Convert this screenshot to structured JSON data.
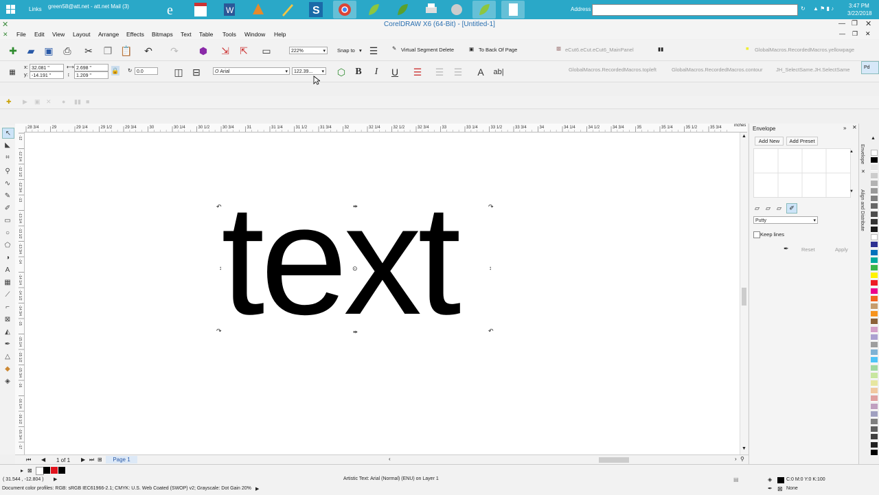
{
  "taskbar": {
    "links_label": "Links",
    "mail_label": "green58@att.net - att.net Mail (3)",
    "address_label": "Address",
    "time": "3:47 PM",
    "date": "3/22/2018",
    "icons": [
      "windows-start-icon",
      "ie-icon",
      "calendar-icon",
      "word-icon",
      "app-icon",
      "pen-icon",
      "s-app-icon",
      "chrome-icon",
      "leaf-icon",
      "leaf-app-icon",
      "printer-icon",
      "app-icon-2",
      "leaf-app-icon-2",
      "document-icon"
    ]
  },
  "window": {
    "title": "CorelDRAW X6 (64-Bit) - [Untitled-1]"
  },
  "menu": [
    "File",
    "Edit",
    "View",
    "Layout",
    "Arrange",
    "Effects",
    "Bitmaps",
    "Text",
    "Table",
    "Tools",
    "Window",
    "Help"
  ],
  "standard_toolbar": {
    "zoom": "222%",
    "snap_to": "Snap to",
    "virtual_segment_delete": "Virtual Segment Delete",
    "to_back_of_page": "To Back Of Page",
    "macro_main_panel": "eCut6.eCut.eCut6_MainPanel",
    "macro_yellowpage": "GlobalMacros.RecordedMacros.yellowpage"
  },
  "property_bar": {
    "x": "32.081 \"",
    "y": "-14.191 \"",
    "width": "2.698 \"",
    "height": "1.209 \"",
    "angle": "0.0",
    "font": "Arial",
    "font_size": "122.39...",
    "macro_topleft": "GlobalMacros.RecordedMacros.topleft",
    "macro_contour": "GlobalMacros.RecordedMacros.contour",
    "macro_selectsame": "JH_SelectSame.JH.SelectSame",
    "macro_cut": "Pd"
  },
  "ruler": {
    "labels": [
      "28 3/4",
      "29",
      "29 1/4",
      "29 1/2",
      "29 3/4",
      "30",
      "30 1/4",
      "30 1/2",
      "30 3/4",
      "31",
      "31 1/4",
      "31 1/2",
      "31 3/4",
      "32",
      "32 1/4",
      "32 1/2",
      "32 3/4",
      "33",
      "33 1/4",
      "33 1/2",
      "33 3/4",
      "34",
      "34 1/4",
      "34 1/2",
      "34 3/4",
      "35",
      "35 1/4",
      "35 1/2",
      "35 3/4"
    ],
    "units": "inches",
    "v_labels": [
      "-12",
      "-12 1/4",
      "-12 1/2",
      "-12 3/4",
      "-13",
      "-13 1/4",
      "-13 1/2",
      "-13 3/4",
      "-14",
      "-14 1/4",
      "-14 1/2",
      "-14 3/4",
      "-15",
      "-15 1/4",
      "-15 1/2",
      "-15 3/4",
      "-16",
      "-16 1/4",
      "-16 1/2",
      "-16 3/4",
      "-17"
    ]
  },
  "canvas": {
    "artistic_text": "text"
  },
  "page_nav": {
    "page_count": "1 of 1",
    "page_tab": "Page 1"
  },
  "docker": {
    "title": "Envelope",
    "add_new": "Add New",
    "add_preset": "Add Preset",
    "mode": "Putty",
    "keep_lines": "Keep lines",
    "reset": "Reset",
    "apply": "Apply"
  },
  "side_tabs": [
    "Envelope",
    "Align and Distribute"
  ],
  "palette": [
    "#ffffff",
    "#000000",
    "#e6e6e6",
    "#cccccc",
    "#b3b3b3",
    "#999999",
    "#808080",
    "#666666",
    "#4d4d4d",
    "#333333",
    "#1a1a1a",
    "#ffffff",
    "#2e3192",
    "#0071bc",
    "#00a99d",
    "#39b54a",
    "#fff200",
    "#ed1c24",
    "#ec008c",
    "#f26522",
    "#c69c6d",
    "#f7941d",
    "#8c6239",
    "#d4a0c8",
    "#aba0d0",
    "#9e9e9e",
    "#7fb2d4",
    "#4fc3f7",
    "#a0d8a0",
    "#c8e6a0",
    "#e6e6a0",
    "#f0c8a0",
    "#e0a0a0",
    "#c0a0c0",
    "#a0a0c0",
    "#808080",
    "#606060",
    "#404040",
    "#202020",
    "#000000"
  ],
  "status": {
    "coords": "( 31.544 , -12.804 )",
    "object_info": "Artistic Text: Arial (Normal) (ENU) on Layer 1",
    "fill": "C:0 M:0 Y:0 K:100",
    "outline": "None",
    "color_profiles": "Document color profiles: RGB: sRGB IEC61966-2.1; CMYK: U.S. Web Coated (SWOP) v2; Grayscale: Dot Gain 20%"
  },
  "colors": {
    "taskbar": "#2aa8c8",
    "title": "#2a6fb0",
    "accent": "#3399ff"
  }
}
